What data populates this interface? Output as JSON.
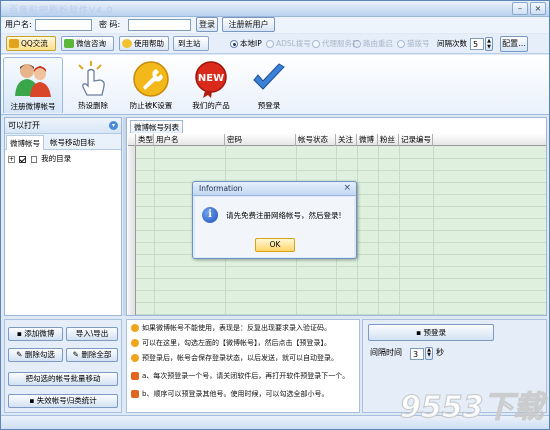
{
  "app": {
    "title": "百度贴吧刷粉软件V4.0",
    "window_controls": {
      "minimize": "–",
      "close": "×"
    }
  },
  "login": {
    "username_label": "用户名:",
    "username_value": "",
    "password_label": "密  码:",
    "password_value": "",
    "login_btn": "登录",
    "register_btn": "注册新用户"
  },
  "toolbar": {
    "qq_btn": "QQ交流",
    "wechat_btn": "微信咨询",
    "help_btn": "使用帮助",
    "site_btn": "到主站",
    "radios": [
      {
        "label": "本地IP",
        "checked": true,
        "enabled": true
      },
      {
        "label": "ADSL拨号",
        "checked": false,
        "enabled": false
      },
      {
        "label": "代理服务器",
        "checked": false,
        "enabled": false
      },
      {
        "label": "路由重启",
        "checked": false,
        "enabled": false
      },
      {
        "label": "猫拨号",
        "checked": false,
        "enabled": false
      }
    ],
    "redial_label": "间隔次数",
    "redial_value": "5",
    "config_btn": "配置..."
  },
  "iconbar": {
    "items": [
      {
        "label": "注册微博帐号",
        "icon": "users-icon",
        "selected": true
      },
      {
        "label": "热设删除",
        "icon": "hand-click-icon",
        "selected": false
      },
      {
        "label": "防止被K设置",
        "icon": "wrench-icon",
        "selected": false
      },
      {
        "label": "我们的产品",
        "icon": "new-badge-icon",
        "selected": false
      },
      {
        "label": "预登录",
        "icon": "checkmark-icon",
        "selected": false
      }
    ]
  },
  "left_panel": {
    "header": "可以打开",
    "tabs": [
      "微博帐号",
      "帐号移动目标"
    ],
    "tree": [
      {
        "label": "我的目录",
        "checked": true
      }
    ]
  },
  "account_list": {
    "tab": "微博帐号列表",
    "columns": [
      "类型",
      "用户名",
      "密码",
      "帐号状态",
      "关注",
      "微博",
      "粉丝",
      "记录编号"
    ]
  },
  "left_buttons": {
    "add_account": "添加微博",
    "import_export": "导入\\导出",
    "delete_checked": "删除勾选",
    "delete_all": "删除全部",
    "batch_move": "把勾选的帐号批量移动",
    "stats": "失效帐号归类统计"
  },
  "tips": [
    "如果微博帐号不能使用，表现是：反复出现要求录入验证码。",
    "可以在这里，勾选左面的【微博帐号】，然后点击【预登录】。",
    "预登录后，帐号会保存登录状态，以后发送，就可以自动登录。",
    "a、每次预登录一个号，请关闭软件后，再打开软件预登录下一个。",
    "b、顺序可以预登录其他号。使用时候，可以勾选全部小号。"
  ],
  "prelogin": {
    "button": "预登录",
    "interval_label": "间隔时间",
    "interval_value": "3",
    "interval_unit": "秒"
  },
  "dialog": {
    "title": "Information",
    "close": "×",
    "message": "请先免费注册网络帐号，然后登录!",
    "ok": "OK"
  },
  "watermark": {
    "text": "9553下载"
  },
  "colors": {
    "grid_bg": "#dff0df",
    "accent": "#1f4fb8",
    "ok_button": "#ffd46b"
  }
}
